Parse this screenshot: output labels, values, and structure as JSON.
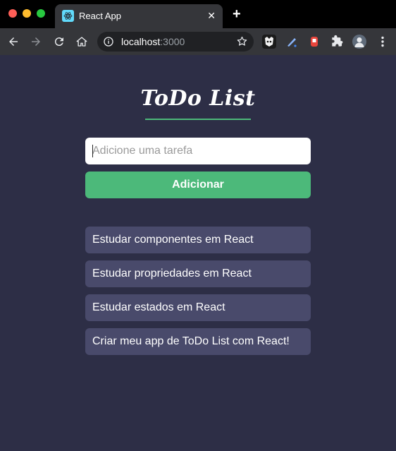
{
  "browser": {
    "tab_title": "React App",
    "url_host": "localhost",
    "url_port": ":3000",
    "icons": [
      "close-icon",
      "plus-icon",
      "back-icon",
      "forward-icon",
      "reload-icon",
      "home-icon",
      "info-icon",
      "star-icon",
      "puzzle-icon",
      "menu-icon"
    ]
  },
  "app": {
    "title": "ToDo List",
    "input_placeholder": "Adicione uma tarefa",
    "add_label": "Adicionar",
    "colors": {
      "background": "#2d2e46",
      "accent": "#4cb97a",
      "task": "#494a6b"
    },
    "tasks": [
      "Estudar componentes em React",
      "Estudar propriedades em React",
      "Estudar estados em React",
      "Criar meu app de ToDo List com React!"
    ]
  }
}
